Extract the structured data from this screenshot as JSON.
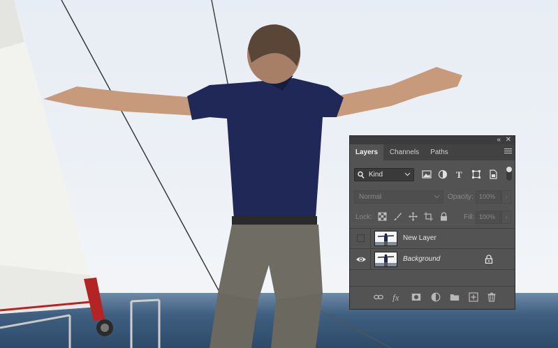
{
  "panel": {
    "topbar": {
      "collapse_glyph": "«",
      "close_glyph": "✕"
    },
    "tabs": [
      {
        "label": "Layers",
        "active": true
      },
      {
        "label": "Channels",
        "active": false
      },
      {
        "label": "Paths",
        "active": false
      }
    ],
    "menu_icon": "panel-menu-icon",
    "filter": {
      "kind_label": "Kind",
      "icons": [
        "pixel-filter-icon",
        "adjustment-filter-icon",
        "type-filter-icon",
        "shape-filter-icon",
        "smart-object-filter-icon"
      ]
    },
    "blend_mode": "Normal",
    "opacity_label": "Opacity:",
    "opacity_value": "100%",
    "lock_label": "Lock:",
    "fill_label": "Fill:",
    "fill_value": "100%",
    "layers": [
      {
        "name": "New Layer",
        "visible": false,
        "italic": false,
        "locked": false
      },
      {
        "name": "Background",
        "visible": true,
        "italic": true,
        "locked": true
      }
    ],
    "footer_icons": [
      "link-layers-icon",
      "fx-icon",
      "mask-icon",
      "adjustment-layer-icon",
      "folder-icon",
      "new-layer-icon",
      "trash-icon"
    ],
    "colors": {
      "panel_bg": "#535353",
      "tab_bar": "#424242",
      "text": "#d6d6d6"
    }
  }
}
